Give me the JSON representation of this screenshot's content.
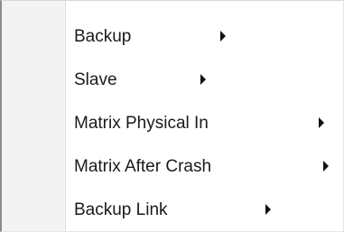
{
  "menu": {
    "items": [
      {
        "label": "Backup",
        "has_submenu": true
      },
      {
        "label": "Slave",
        "has_submenu": true
      },
      {
        "label": "Matrix Physical In",
        "has_submenu": true
      },
      {
        "label": "Matrix After Crash",
        "has_submenu": true
      },
      {
        "label": "Backup Link",
        "has_submenu": true
      }
    ],
    "submenu_icon": "chevron-right-icon",
    "colors": {
      "background": "#ffffff",
      "gutter": "#f3f3f3",
      "text": "#1a1a1a"
    }
  }
}
